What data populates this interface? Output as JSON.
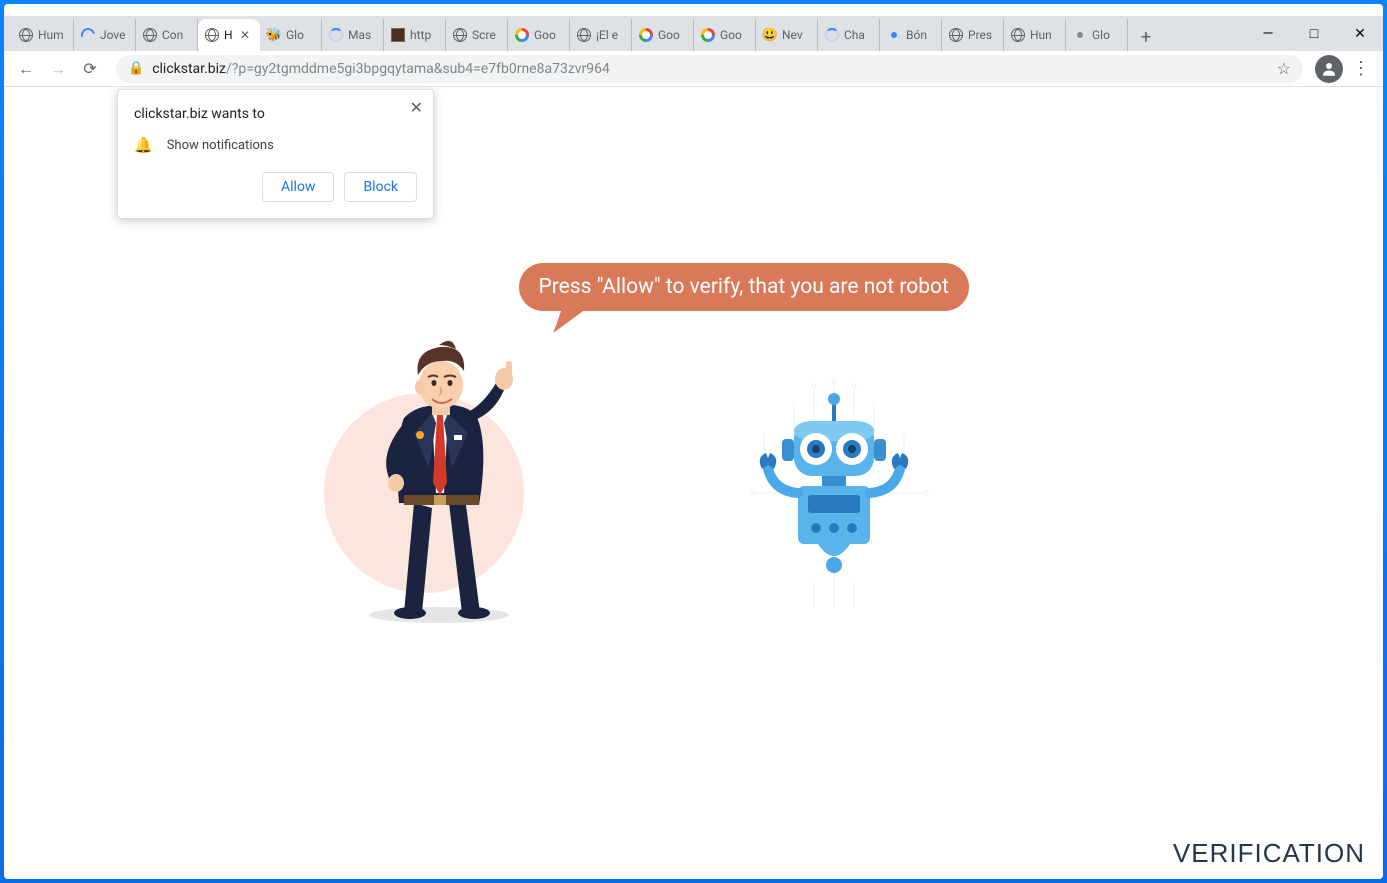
{
  "window_controls": {
    "minimize": "—",
    "maximize": "□",
    "close": "✕"
  },
  "tabs": [
    {
      "label": "Hum",
      "icon": "globe"
    },
    {
      "label": "Jove",
      "icon": "arc"
    },
    {
      "label": "Con",
      "icon": "globe"
    },
    {
      "label": "H",
      "icon": "globe",
      "active": true,
      "closable": true
    },
    {
      "label": "Glo",
      "icon": "bee"
    },
    {
      "label": "Mas",
      "icon": "spinner"
    },
    {
      "label": "http",
      "icon": "square"
    },
    {
      "label": "Scre",
      "icon": "globe"
    },
    {
      "label": "Goo",
      "icon": "google"
    },
    {
      "label": "¡El e",
      "icon": "globe"
    },
    {
      "label": "Goo",
      "icon": "google"
    },
    {
      "label": "Goo",
      "icon": "google"
    },
    {
      "label": "Nev",
      "icon": "emoji"
    },
    {
      "label": "Cha",
      "icon": "spinner"
    },
    {
      "label": "Bón",
      "icon": "dot"
    },
    {
      "label": "Pres",
      "icon": "globe"
    },
    {
      "label": "Hun",
      "icon": "globe"
    },
    {
      "label": "Glo",
      "icon": "dot2"
    }
  ],
  "newtab": "+",
  "nav": {
    "back": "←",
    "forward": "→",
    "reload": "⟳"
  },
  "url": {
    "domain": "clickstar.biz",
    "path": "/?p=gy2tgmddme5gi3bpgqytama&sub4=e7fb0rne8a73zvr964"
  },
  "permission": {
    "close": "✕",
    "title": "clickstar.biz wants to",
    "text": "Show notifications",
    "allow": "Allow",
    "block": "Block"
  },
  "bubble": "Press \"Allow\" to verify, that you are not robot",
  "verification": "VERIFICATION"
}
